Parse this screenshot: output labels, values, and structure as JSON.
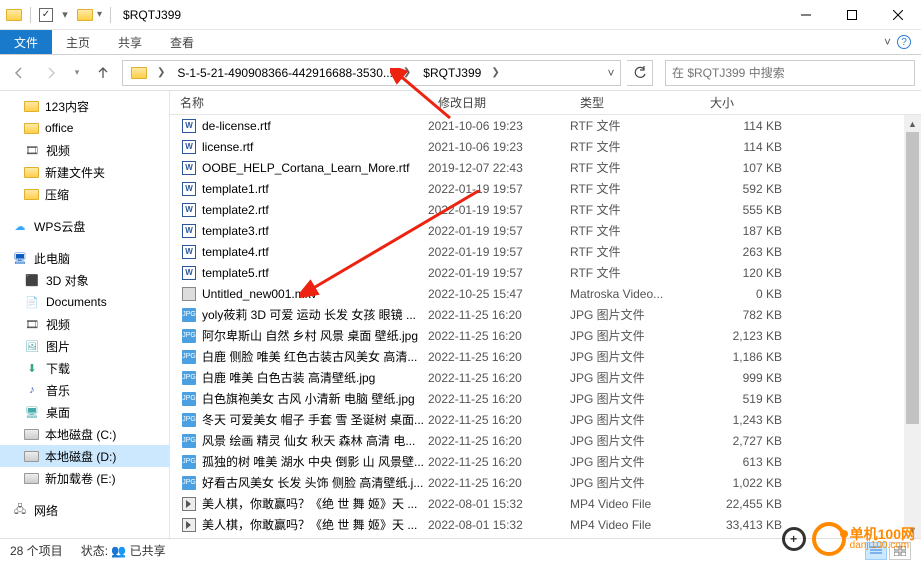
{
  "window": {
    "title": "$RQTJ399"
  },
  "ribbon": {
    "file": "文件",
    "tabs": [
      "主页",
      "共享",
      "查看"
    ]
  },
  "address": {
    "segments": [
      "S-1-5-21-490908366-442916688-3530...",
      "$RQTJ399"
    ]
  },
  "search": {
    "placeholder": "在 $RQTJ399 中搜索"
  },
  "nav": {
    "quick": [
      {
        "label": "123内容",
        "icon": "folder"
      },
      {
        "label": "office",
        "icon": "folder"
      },
      {
        "label": "视频",
        "icon": "video"
      },
      {
        "label": "新建文件夹",
        "icon": "folder"
      },
      {
        "label": "压缩",
        "icon": "folder"
      }
    ],
    "wps": "WPS云盘",
    "pc": "此电脑",
    "pc_items": [
      {
        "label": "3D 对象",
        "icon": "3d"
      },
      {
        "label": "Documents",
        "icon": "doc"
      },
      {
        "label": "视频",
        "icon": "video"
      },
      {
        "label": "图片",
        "icon": "pic"
      },
      {
        "label": "下载",
        "icon": "down"
      },
      {
        "label": "音乐",
        "icon": "music"
      },
      {
        "label": "桌面",
        "icon": "desk"
      },
      {
        "label": "本地磁盘 (C:)",
        "icon": "drive"
      },
      {
        "label": "本地磁盘 (D:)",
        "icon": "drive",
        "sel": true
      },
      {
        "label": "新加载卷 (E:)",
        "icon": "drive"
      }
    ],
    "network": "网络"
  },
  "columns": {
    "name": "名称",
    "date": "修改日期",
    "type": "类型",
    "size": "大小"
  },
  "files": [
    {
      "name": "de-license.rtf",
      "date": "2021-10-06 19:23",
      "type": "RTF 文件",
      "size": "114 KB",
      "ico": "rtf"
    },
    {
      "name": "license.rtf",
      "date": "2021-10-06 19:23",
      "type": "RTF 文件",
      "size": "114 KB",
      "ico": "rtf"
    },
    {
      "name": "OOBE_HELP_Cortana_Learn_More.rtf",
      "date": "2019-12-07 22:43",
      "type": "RTF 文件",
      "size": "107 KB",
      "ico": "rtf"
    },
    {
      "name": "template1.rtf",
      "date": "2022-01-19 19:57",
      "type": "RTF 文件",
      "size": "592 KB",
      "ico": "rtf"
    },
    {
      "name": "template2.rtf",
      "date": "2022-01-19 19:57",
      "type": "RTF 文件",
      "size": "555 KB",
      "ico": "rtf"
    },
    {
      "name": "template3.rtf",
      "date": "2022-01-19 19:57",
      "type": "RTF 文件",
      "size": "187 KB",
      "ico": "rtf"
    },
    {
      "name": "template4.rtf",
      "date": "2022-01-19 19:57",
      "type": "RTF 文件",
      "size": "263 KB",
      "ico": "rtf"
    },
    {
      "name": "template5.rtf",
      "date": "2022-01-19 19:57",
      "type": "RTF 文件",
      "size": "120 KB",
      "ico": "rtf"
    },
    {
      "name": "Untitled_new001.mkv",
      "date": "2022-10-25 15:47",
      "type": "Matroska Video...",
      "size": "0 KB",
      "ico": "mkv"
    },
    {
      "name": "yoly莜莉 3D 可爱 运动 长发 女孩 眼镜 ...",
      "date": "2022-11-25 16:20",
      "type": "JPG 图片文件",
      "size": "782 KB",
      "ico": "jpg"
    },
    {
      "name": "阿尔卑斯山 自然 乡村 风景 桌面 壁纸.jpg",
      "date": "2022-11-25 16:20",
      "type": "JPG 图片文件",
      "size": "2,123 KB",
      "ico": "jpg"
    },
    {
      "name": "白鹿 侧脸 唯美 红色古装古风美女 高清...",
      "date": "2022-11-25 16:20",
      "type": "JPG 图片文件",
      "size": "1,186 KB",
      "ico": "jpg"
    },
    {
      "name": "白鹿 唯美 白色古装 高清壁纸.jpg",
      "date": "2022-11-25 16:20",
      "type": "JPG 图片文件",
      "size": "999 KB",
      "ico": "jpg"
    },
    {
      "name": "白色旗袍美女 古风 小清新 电脑 壁纸.jpg",
      "date": "2022-11-25 16:20",
      "type": "JPG 图片文件",
      "size": "519 KB",
      "ico": "jpg"
    },
    {
      "name": "冬天 可爱美女 帽子 手套 雪 圣诞树 桌面...",
      "date": "2022-11-25 16:20",
      "type": "JPG 图片文件",
      "size": "1,243 KB",
      "ico": "jpg"
    },
    {
      "name": "风景 绘画 精灵 仙女 秋天 森林 高清 电...",
      "date": "2022-11-25 16:20",
      "type": "JPG 图片文件",
      "size": "2,727 KB",
      "ico": "jpg"
    },
    {
      "name": "孤独的树 唯美 湖水 中央 倒影 山 风景壁...",
      "date": "2022-11-25 16:20",
      "type": "JPG 图片文件",
      "size": "613 KB",
      "ico": "jpg"
    },
    {
      "name": "好看古风美女 长发 头饰 侧脸 高清壁纸.j...",
      "date": "2022-11-25 16:20",
      "type": "JPG 图片文件",
      "size": "1,022 KB",
      "ico": "jpg"
    },
    {
      "name": "美人棋，你敢赢吗？《绝 世 舞 姬》天 ...",
      "date": "2022-08-01 15:32",
      "type": "MP4 Video File",
      "size": "22,455 KB",
      "ico": "mp4"
    },
    {
      "name": "美人棋，你敢赢吗？《绝 世 舞 姬》天 ...",
      "date": "2022-08-01 15:32",
      "type": "MP4 Video File",
      "size": "33,413 KB",
      "ico": "mp4"
    }
  ],
  "status": {
    "count": "28 个项目",
    "state_label": "状态:",
    "state_value": "已共享"
  },
  "watermark": {
    "brand": "单机100网",
    "url": "danji100.com"
  }
}
